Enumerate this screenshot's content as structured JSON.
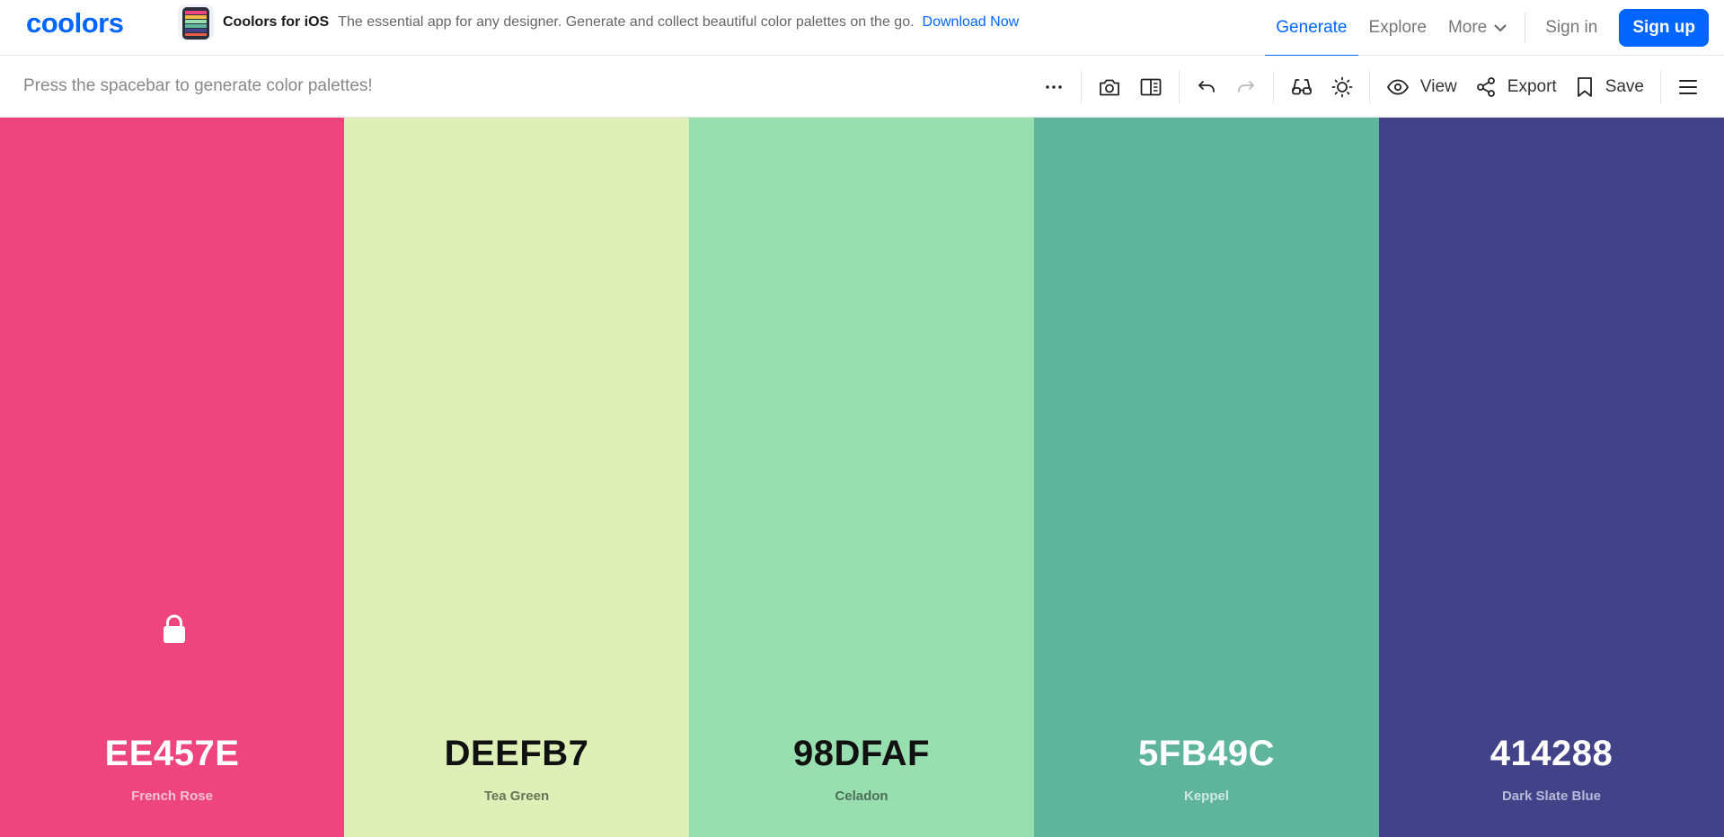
{
  "brand": {
    "logo_text": "coolors",
    "color": "#0066ff"
  },
  "promo": {
    "title": "Coolors for iOS",
    "text": "The essential app for any designer. Generate and collect beautiful color palettes on the go.",
    "link": "Download Now"
  },
  "nav": {
    "generate": "Generate",
    "explore": "Explore",
    "more": "More",
    "signin": "Sign in",
    "signup": "Sign up"
  },
  "toolbar": {
    "hint": "Press the spacebar to generate color palettes!",
    "icons": [
      "more-options-icon",
      "camera-icon",
      "split-view-icon",
      "undo-icon",
      "redo-icon",
      "glasses-icon",
      "sun-icon",
      "eye-icon",
      "share-icon",
      "bookmark-icon",
      "menu-icon"
    ],
    "view_label": "View",
    "export_label": "Export",
    "save_label": "Save"
  },
  "palette": [
    {
      "hex": "EE457E",
      "name": "French Rose",
      "color": "#EE457E",
      "text_color": "#ffffff",
      "name_color": "#f7c2d3",
      "locked": true
    },
    {
      "hex": "DEEFB7",
      "name": "Tea Green",
      "color": "#DEEFB7",
      "text_color": "#111111",
      "name_color": "#6c7358",
      "locked": false
    },
    {
      "hex": "98DFAF",
      "name": "Celadon",
      "color": "#98DFAF",
      "text_color": "#111111",
      "name_color": "#4c6f58",
      "locked": false
    },
    {
      "hex": "5FB49C",
      "name": "Keppel",
      "color": "#5FB49C",
      "text_color": "#ffffff",
      "name_color": "#cfe9e1",
      "locked": false
    },
    {
      "hex": "414288",
      "name": "Dark Slate Blue",
      "color": "#414288",
      "text_color": "#ffffff",
      "name_color": "#b9b9d9",
      "locked": false
    }
  ]
}
